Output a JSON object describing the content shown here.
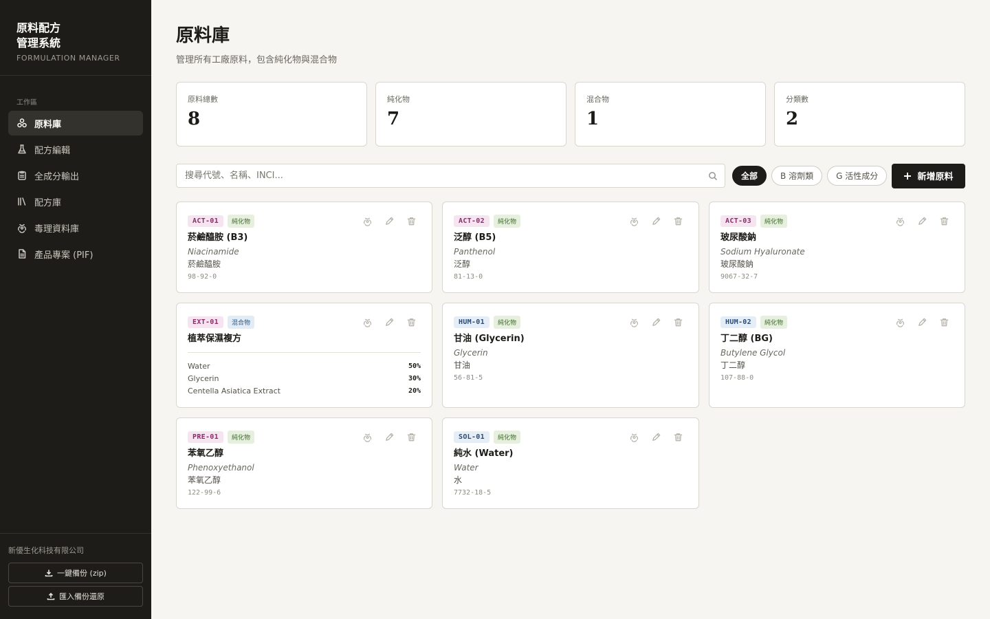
{
  "brand": {
    "title_line1": "原料配方",
    "title_line2": "管理系統",
    "subtitle": "FORMULATION MANAGER"
  },
  "sidebar": {
    "section_label": "工作區",
    "items": [
      {
        "label": "原料庫",
        "icon": "molecule-icon",
        "active": true
      },
      {
        "label": "配方編輯",
        "icon": "flask-icon",
        "active": false
      },
      {
        "label": "全成分輸出",
        "icon": "clipboard-icon",
        "active": false
      },
      {
        "label": "配方庫",
        "icon": "library-icon",
        "active": false
      },
      {
        "label": "毒理資料庫",
        "icon": "biohazard-icon",
        "active": false
      },
      {
        "label": "產品專案 (PIF)",
        "icon": "document-icon",
        "active": false
      }
    ],
    "company": "新優生化科技有限公司",
    "backup_label": "一鍵備份 (zip)",
    "restore_label": "匯入備份還原"
  },
  "page": {
    "title": "原料庫",
    "description": "管理所有工廠原料，包含純化物與混合物"
  },
  "stats": [
    {
      "label": "原料總數",
      "value": "8"
    },
    {
      "label": "純化物",
      "value": "7"
    },
    {
      "label": "混合物",
      "value": "1"
    },
    {
      "label": "分類數",
      "value": "2"
    }
  ],
  "search": {
    "placeholder": "搜尋代號、名稱、INCI..."
  },
  "filters": [
    {
      "label": "全部",
      "active": true
    },
    {
      "label": "B 溶劑類",
      "active": false
    },
    {
      "label": "G 活性成分",
      "active": false
    }
  ],
  "add_button": "新增原料",
  "colors": {
    "sidebar_bg": "#1d1c18",
    "pure_badge_bg": "#e7f0de",
    "pure_badge_fg": "#3f6b2d",
    "mix_badge_bg": "#e2ecf6",
    "mix_badge_fg": "#2f5a86",
    "act_code_bg": "#f6e4f0",
    "act_code_fg": "#8a2c6a",
    "hum_code_bg": "#e5edf6",
    "hum_code_fg": "#2c4a72"
  },
  "materials": [
    {
      "code": "ACT-01",
      "type": "純化物",
      "name": "菸鹼醯胺 (B3)",
      "inci": "Niacinamide",
      "zh": "菸鹼醯胺",
      "cas": "98-92-0"
    },
    {
      "code": "ACT-02",
      "type": "純化物",
      "name": "泛醇 (B5)",
      "inci": "Panthenol",
      "zh": "泛醇",
      "cas": "81-13-0"
    },
    {
      "code": "ACT-03",
      "type": "純化物",
      "name": "玻尿酸鈉",
      "inci": "Sodium Hyaluronate",
      "zh": "玻尿酸鈉",
      "cas": "9067-32-7"
    },
    {
      "code": "EXT-01",
      "type": "混合物",
      "name": "植萃保濕複方",
      "components": [
        {
          "name": "Water",
          "pct": "50%"
        },
        {
          "name": "Glycerin",
          "pct": "30%"
        },
        {
          "name": "Centella Asiatica Extract",
          "pct": "20%"
        }
      ]
    },
    {
      "code": "HUM-01",
      "type": "純化物",
      "name": "甘油 (Glycerin)",
      "inci": "Glycerin",
      "zh": "甘油",
      "cas": "56-81-5"
    },
    {
      "code": "HUM-02",
      "type": "純化物",
      "name": "丁二醇 (BG)",
      "inci": "Butylene Glycol",
      "zh": "丁二醇",
      "cas": "107-88-0"
    },
    {
      "code": "PRE-01",
      "type": "純化物",
      "name": "苯氧乙醇",
      "inci": "Phenoxyethanol",
      "zh": "苯氧乙醇",
      "cas": "122-99-6"
    },
    {
      "code": "SOL-01",
      "type": "純化物",
      "name": "純水 (Water)",
      "inci": "Water",
      "zh": "水",
      "cas": "7732-18-5"
    }
  ]
}
